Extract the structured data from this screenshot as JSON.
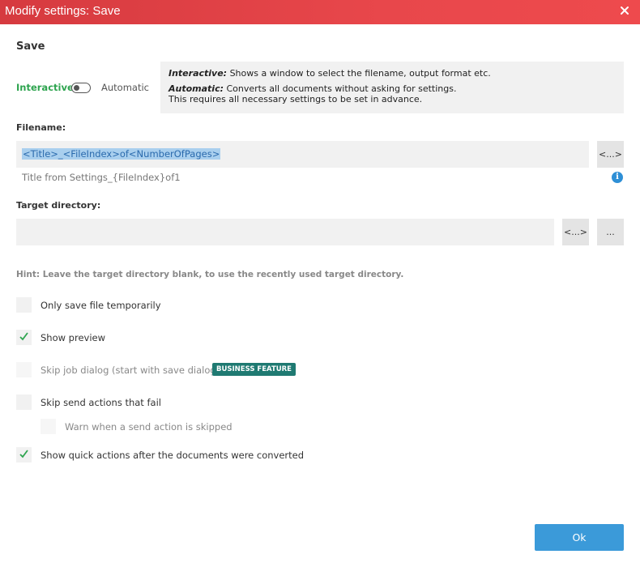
{
  "window": {
    "title": "Modify settings: Save"
  },
  "section": {
    "title": "Save"
  },
  "mode": {
    "interactive_label": "Interactive",
    "automatic_label": "Automatic"
  },
  "info": {
    "interactive_title": "Interactive:",
    "interactive_text": " Shows a window to select the filename, output format etc.",
    "automatic_title": "Automatic:",
    "automatic_text": " Converts all documents without asking for settings.",
    "automatic_text2": "This requires all necessary settings to be set in advance."
  },
  "filename": {
    "label": "Filename:",
    "value": "<Title>_<FileIndex>of<NumberOfPages>",
    "token_button": "<...>",
    "preview": "Title from Settings_{FileIndex}of1",
    "info_icon": "i"
  },
  "target": {
    "label": "Target directory:",
    "value": "",
    "token_button": "<...>",
    "browse_button": "...",
    "hint": "Hint: Leave the target directory blank, to use the recently used target directory."
  },
  "options": {
    "only_temp": "Only save file temporarily",
    "show_preview": "Show preview",
    "skip_job_dialog": "Skip job dialog (start with save dialog)",
    "business_badge": "BUSINESS FEATURE",
    "skip_send_actions": "Skip send actions that fail",
    "warn_skipped": "Warn when a send action is skipped",
    "show_quick_actions": "Show quick actions after the documents were converted"
  },
  "ok_button": "Ok",
  "colors": {
    "accent": "#e8474b",
    "check": "#2ea44f",
    "primary_button": "#3b9ad9",
    "badge": "#1f7a72"
  }
}
